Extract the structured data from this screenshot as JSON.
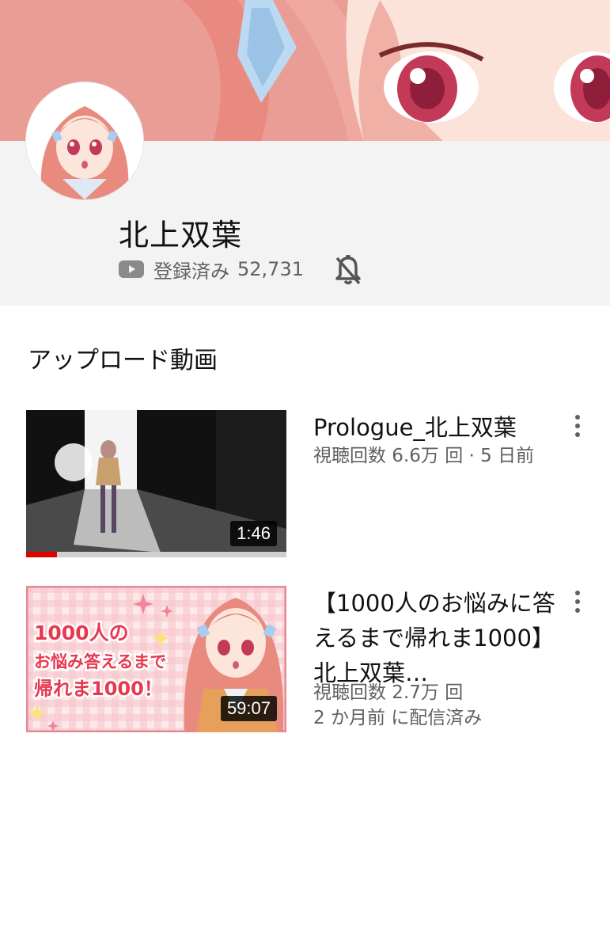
{
  "channel": {
    "name": "北上双葉",
    "subscribed_label": "登録済み",
    "subscriber_count": "52,731"
  },
  "section": {
    "title": "アップロード動画"
  },
  "videos": [
    {
      "title": "Prologue_北上双葉",
      "meta_line1": "視聴回数 6.6万 回 · 5 日前",
      "meta_line2": "",
      "duration": "1:46",
      "watch_progress": 0.12
    },
    {
      "title": "【1000人のお悩みに答えるまで帰れま1000】北上双葉…",
      "meta_line1": "視聴回数 2.7万 回",
      "meta_line2": "2 か月前 に配信済み",
      "duration": "59:07",
      "thumbnail_text": [
        "1000人の",
        "お悩み答えるまで",
        "帰れま1000！"
      ]
    }
  ],
  "colors": {
    "banner": "#e79a92",
    "header_bg": "#f3f3f3",
    "accent_red": "#e00000",
    "meta_gray": "#606060"
  }
}
